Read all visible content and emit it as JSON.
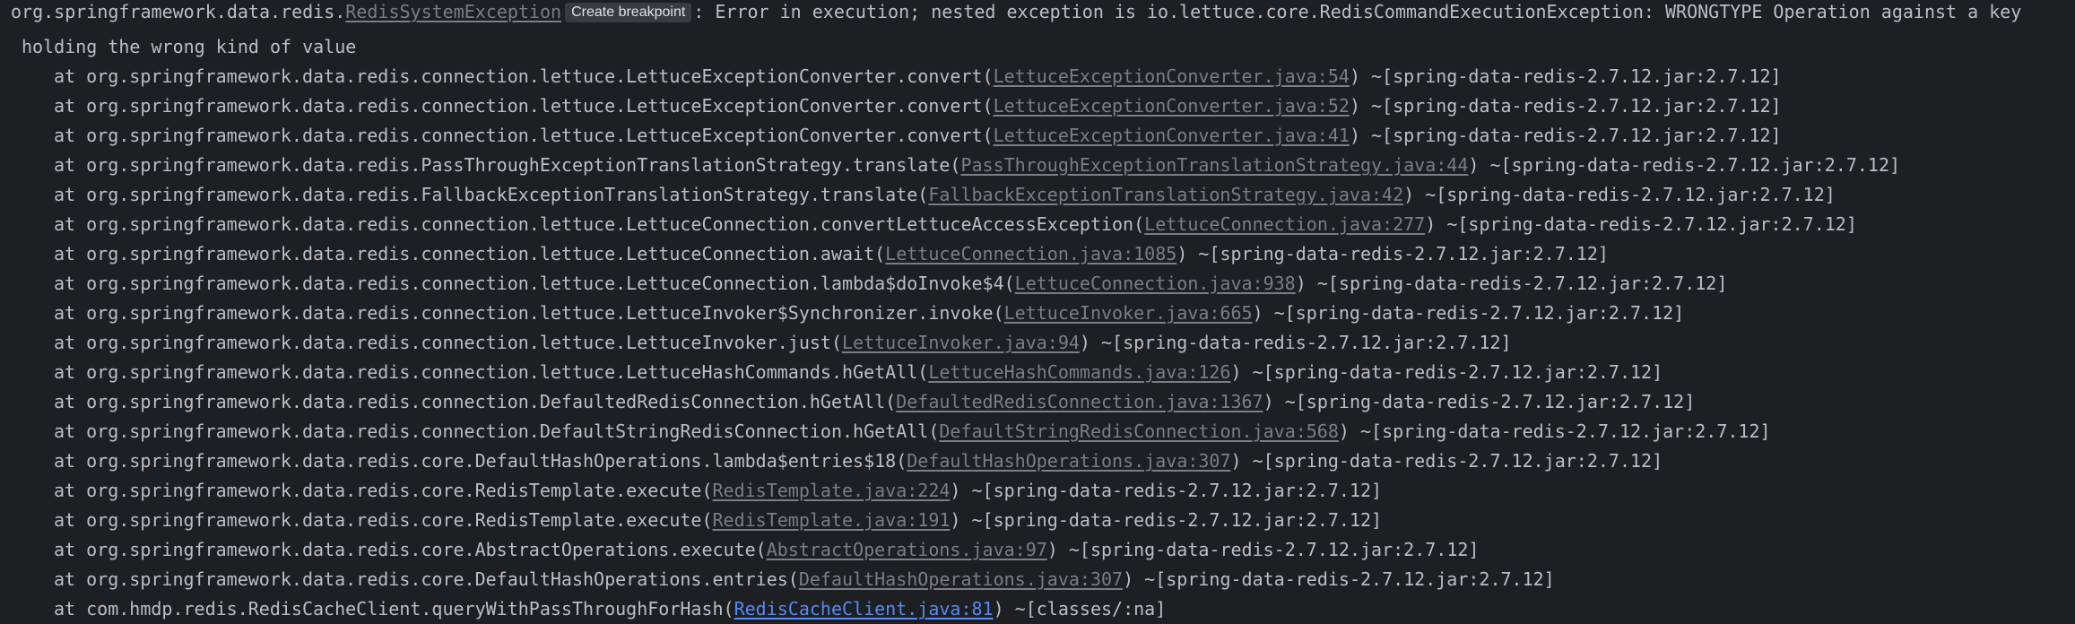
{
  "exception": {
    "prefix": "org.springframework.data.redis.",
    "class_link": "RedisSystemException",
    "breakpoint_label": "Create breakpoint",
    "message": ": Error in execution; nested exception is io.lettuce.core.RedisCommandExecutionException: WRONGTYPE Operation against a key",
    "message_cont": "holding the wrong kind of value"
  },
  "frames": [
    {
      "method": "at org.springframework.data.redis.connection.lettuce.LettuceExceptionConverter.convert(",
      "source": "LettuceExceptionConverter.java:54",
      "jar": ") ~[spring-data-redis-2.7.12.jar:2.7.12]"
    },
    {
      "method": "at org.springframework.data.redis.connection.lettuce.LettuceExceptionConverter.convert(",
      "source": "LettuceExceptionConverter.java:52",
      "jar": ") ~[spring-data-redis-2.7.12.jar:2.7.12]"
    },
    {
      "method": "at org.springframework.data.redis.connection.lettuce.LettuceExceptionConverter.convert(",
      "source": "LettuceExceptionConverter.java:41",
      "jar": ") ~[spring-data-redis-2.7.12.jar:2.7.12]"
    },
    {
      "method": "at org.springframework.data.redis.PassThroughExceptionTranslationStrategy.translate(",
      "source": "PassThroughExceptionTranslationStrategy.java:44",
      "jar": ") ~[spring-data-redis-2.7.12.jar:2.7.12]"
    },
    {
      "method": "at org.springframework.data.redis.FallbackExceptionTranslationStrategy.translate(",
      "source": "FallbackExceptionTranslationStrategy.java:42",
      "jar": ") ~[spring-data-redis-2.7.12.jar:2.7.12]"
    },
    {
      "method": "at org.springframework.data.redis.connection.lettuce.LettuceConnection.convertLettuceAccessException(",
      "source": "LettuceConnection.java:277",
      "jar": ") ~[spring-data-redis-2.7.12.jar:2.7.12]"
    },
    {
      "method": "at org.springframework.data.redis.connection.lettuce.LettuceConnection.await(",
      "source": "LettuceConnection.java:1085",
      "jar": ") ~[spring-data-redis-2.7.12.jar:2.7.12]"
    },
    {
      "method": "at org.springframework.data.redis.connection.lettuce.LettuceConnection.lambda$doInvoke$4(",
      "source": "LettuceConnection.java:938",
      "jar": ") ~[spring-data-redis-2.7.12.jar:2.7.12]"
    },
    {
      "method": "at org.springframework.data.redis.connection.lettuce.LettuceInvoker$Synchronizer.invoke(",
      "source": "LettuceInvoker.java:665",
      "jar": ") ~[spring-data-redis-2.7.12.jar:2.7.12]"
    },
    {
      "method": "at org.springframework.data.redis.connection.lettuce.LettuceInvoker.just(",
      "source": "LettuceInvoker.java:94",
      "jar": ") ~[spring-data-redis-2.7.12.jar:2.7.12]"
    },
    {
      "method": "at org.springframework.data.redis.connection.lettuce.LettuceHashCommands.hGetAll(",
      "source": "LettuceHashCommands.java:126",
      "jar": ") ~[spring-data-redis-2.7.12.jar:2.7.12]"
    },
    {
      "method": "at org.springframework.data.redis.connection.DefaultedRedisConnection.hGetAll(",
      "source": "DefaultedRedisConnection.java:1367",
      "jar": ") ~[spring-data-redis-2.7.12.jar:2.7.12]"
    },
    {
      "method": "at org.springframework.data.redis.connection.DefaultStringRedisConnection.hGetAll(",
      "source": "DefaultStringRedisConnection.java:568",
      "jar": ") ~[spring-data-redis-2.7.12.jar:2.7.12]"
    },
    {
      "method": "at org.springframework.data.redis.core.DefaultHashOperations.lambda$entries$18(",
      "source": "DefaultHashOperations.java:307",
      "jar": ") ~[spring-data-redis-2.7.12.jar:2.7.12]"
    },
    {
      "method": "at org.springframework.data.redis.core.RedisTemplate.execute(",
      "source": "RedisTemplate.java:224",
      "jar": ") ~[spring-data-redis-2.7.12.jar:2.7.12]"
    },
    {
      "method": "at org.springframework.data.redis.core.RedisTemplate.execute(",
      "source": "RedisTemplate.java:191",
      "jar": ") ~[spring-data-redis-2.7.12.jar:2.7.12]"
    },
    {
      "method": "at org.springframework.data.redis.core.AbstractOperations.execute(",
      "source": "AbstractOperations.java:97",
      "jar": ") ~[spring-data-redis-2.7.12.jar:2.7.12]"
    },
    {
      "method": "at org.springframework.data.redis.core.DefaultHashOperations.entries(",
      "source": "DefaultHashOperations.java:307",
      "jar": ") ~[spring-data-redis-2.7.12.jar:2.7.12]"
    },
    {
      "method": "at com.hmdp.redis.RedisCacheClient.queryWithPassThroughForHash(",
      "source": "RedisCacheClient.java:81",
      "jar": ") ~[classes/:na]",
      "project_frame": true
    }
  ],
  "colors": {
    "background": "#1e1f22",
    "text": "#bcbec4",
    "library_link": "#7a7e85",
    "project_link": "#548af7"
  }
}
